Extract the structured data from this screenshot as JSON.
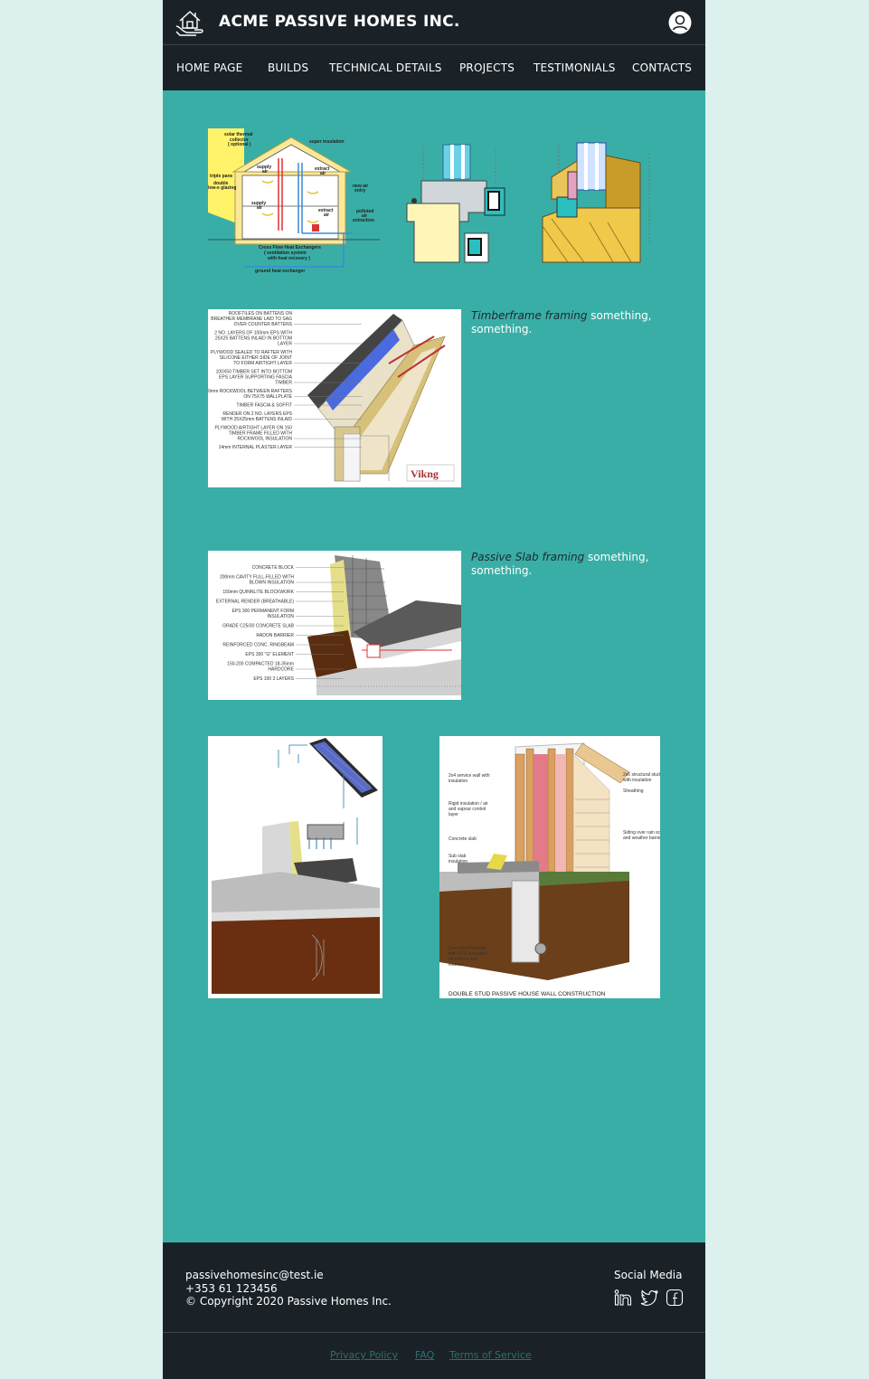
{
  "header": {
    "brand": "ACME PASSIVE HOMES INC.",
    "logo_icon": "house-in-hands-icon",
    "account_icon": "user-account-icon"
  },
  "nav": {
    "items": [
      {
        "label": "HOME PAGE"
      },
      {
        "label": "BUILDS"
      },
      {
        "label": "TECHNICAL DETAILS"
      },
      {
        "label": "PROJECTS"
      },
      {
        "label": "TESTIMONIALS"
      },
      {
        "label": "CONTACTS"
      }
    ]
  },
  "figures": {
    "ventilation": {
      "labels": [
        "solar thermal collector ( optional )",
        "super insulation",
        "supply air",
        "extract air",
        "triple pane",
        "double low-e glazing",
        "new air entry",
        "supply air",
        "extract air",
        "polluted air extraction",
        "Cross Flow Heat Exchangers ( ventilation system with heat recovery )",
        "ground heat exchanger"
      ]
    },
    "timberframe": {
      "labels": [
        "ROOFTILES ON BATTENS ON BREATHER MEMBRANE LAID TO SAG OVER COUNTER BATTENS",
        "2 NO. LAYERS OF 100mm EPS WITH 25X25 BATTENS INLAID IN BOTTOM LAYER",
        "PLYWOOD SEALED TO RAFTER WITH SILICONE EITHER SIDE OF JOINT TO FORM AIRTIGHT LAYER",
        "100X50 TIMBER SET INTO BOTTOM EPS LAYER SUPPORTING FASCIA TIMBER",
        "150mm ROCKWOOL BETWEEN RAFTERS ON 75X75 WALLPLATE",
        "TIMBER FASCIA & SOFFIT",
        "RENDER ON 2 NO. LAYERS EPS WITH 25X25mm BATTENS INLAID",
        "PLYWOOD AIRTIGHT LAYER ON 150 TIMBER FRAME FILLED WITH ROCKWOOL INSULATION",
        "14mm INTERNAL PLASTER LAYER"
      ],
      "caption_em": "Timberframe framing",
      "caption_rest": " something, something."
    },
    "passive_slab": {
      "labels": [
        "CONCRETE BLOCK",
        "200mm CAVITY FULL-FILLED WITH BLOWN INSULATION",
        "150mm QUINNLITE BLOCKWORK",
        "EXTERNAL RENDER (BREATHABLE)",
        "EPS 300 PERMANENT FORM INSULATION",
        "GRADE C25/30 CONCRETE SLAB",
        "RADON BARRIER",
        "REINFORCED CONC. RINGBEAM",
        "EPS 300 \"G\" ELEMENT",
        "150-200 COMPACTED 18-35mm HARDCORE",
        "EPS 100 3 LAYERS"
      ],
      "caption_em": "Passive Slab framing",
      "caption_rest": " something, something."
    },
    "double_stud": {
      "title": "DOUBLE STUD PASSIVE HOUSE WALL CONSTRUCTION"
    }
  },
  "footer": {
    "email": "passivehomesinc@test.ie",
    "phone": "+353 61 123456",
    "copyright": "© Copyright 2020 Passive Homes Inc.",
    "social_title": "Social Media",
    "social_icons": [
      "linkedin-icon",
      "twitter-icon",
      "facebook-icon"
    ],
    "legal": {
      "privacy": "Privacy Policy",
      "faq": "FAQ",
      "terms": "Terms of Service"
    }
  },
  "colors": {
    "page_bg": "#dcf0ee",
    "content_bg": "#39aea6",
    "header_bg": "#1a2228",
    "legal_link": "#2f6f6b"
  }
}
